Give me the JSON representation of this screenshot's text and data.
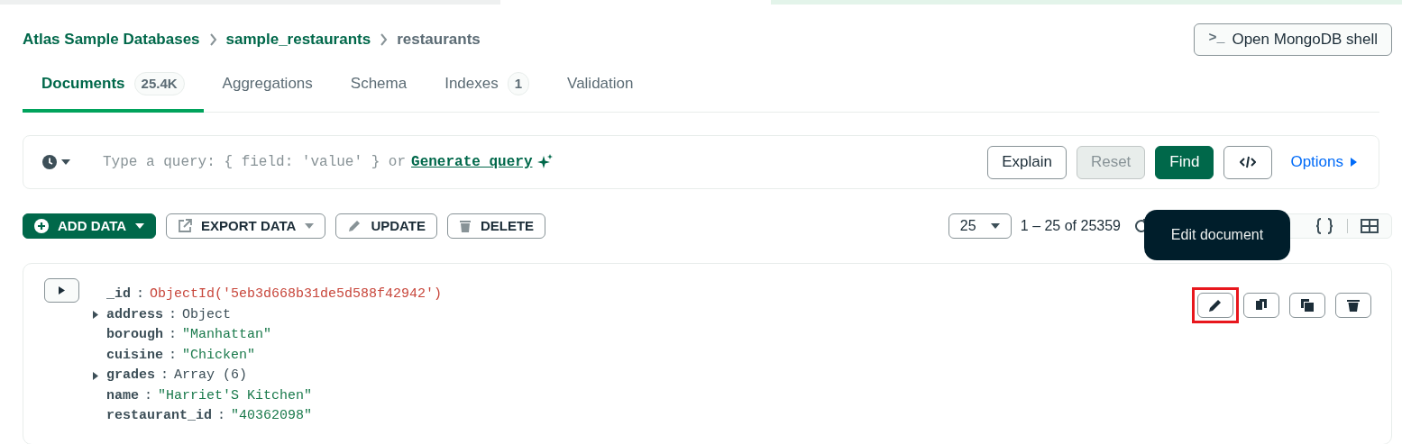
{
  "breadcrumb": [
    {
      "label": "Atlas Sample Databases",
      "current": false
    },
    {
      "label": "sample_restaurants",
      "current": false
    },
    {
      "label": "restaurants",
      "current": true
    }
  ],
  "shell_button": {
    "icon": ">_",
    "label": "Open MongoDB shell"
  },
  "tabs": [
    {
      "label": "Documents",
      "count": "25.4K",
      "selected": true
    },
    {
      "label": "Aggregations",
      "selected": false
    },
    {
      "label": "Schema",
      "selected": false
    },
    {
      "label": "Indexes",
      "count": "1",
      "selected": false
    },
    {
      "label": "Validation",
      "selected": false
    }
  ],
  "query_bar": {
    "placeholder": "Type a query: { field: 'value' } or",
    "generate_link": "Generate query",
    "buttons": [
      {
        "label": "Explain",
        "kind": "outline",
        "disabled": false
      },
      {
        "label": "Reset",
        "kind": "outline",
        "disabled": true
      },
      {
        "label": "Find",
        "kind": "primary",
        "disabled": false
      }
    ],
    "options": "Options"
  },
  "toolbar": {
    "actions": [
      {
        "label": "ADD DATA",
        "kind": "primary",
        "dropdown": true
      },
      {
        "label": "EXPORT DATA",
        "kind": "export",
        "dropdown": true
      },
      {
        "label": "UPDATE",
        "kind": "update",
        "dropdown": false
      },
      {
        "label": "DELETE",
        "kind": "delete",
        "dropdown": false
      }
    ],
    "page_size": "25",
    "range": "1 – 25 of 25359"
  },
  "tooltip": "Edit document",
  "document": {
    "fields": [
      {
        "key": "_id",
        "separator": ":",
        "value": "ObjectId('5eb3d668b31de5d588f42942')",
        "kind": "objectid",
        "expandable": false
      },
      {
        "key": "address",
        "separator": ":",
        "value": "Object",
        "kind": "object",
        "expandable": true
      },
      {
        "key": "borough",
        "separator": ":",
        "value": "\"Manhattan\"",
        "kind": "string",
        "expandable": false
      },
      {
        "key": "cuisine",
        "separator": ":",
        "value": "\"Chicken\"",
        "kind": "string",
        "expandable": false
      },
      {
        "key": "grades",
        "separator": ":",
        "value": "Array (6)",
        "kind": "object",
        "expandable": true
      },
      {
        "key": "name",
        "separator": ":",
        "value": "\"Harriet'S Kitchen\"",
        "kind": "string",
        "expandable": false
      },
      {
        "key": "restaurant_id",
        "separator": ":",
        "value": "\"40362098\"",
        "kind": "string",
        "expandable": false
      }
    ],
    "actions": [
      {
        "kind": "edit",
        "highlighted": true
      },
      {
        "kind": "copy",
        "highlighted": false
      },
      {
        "kind": "clone",
        "highlighted": false
      },
      {
        "kind": "delete",
        "highlighted": false
      }
    ]
  }
}
